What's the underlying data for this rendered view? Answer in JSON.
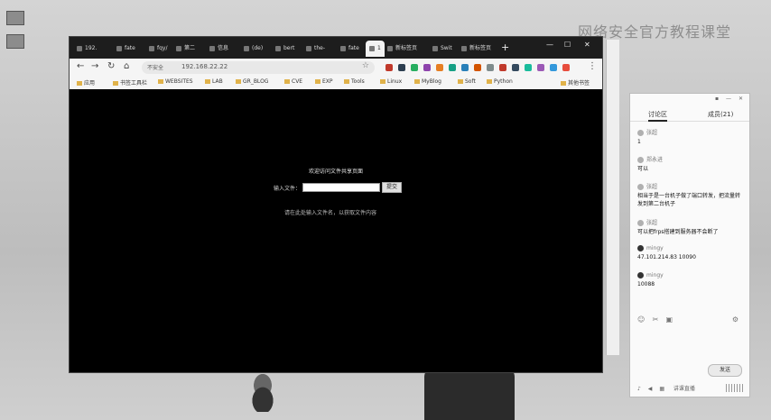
{
  "watermark": "网络安全官方教程课堂",
  "browser": {
    "tabs": [
      "192.",
      "fate",
      "fqy/",
      "第二",
      "信息",
      "(de)",
      "bert",
      "the-",
      "fate",
      "1"
    ],
    "extra_tabs": [
      "新标签页",
      "Swit",
      "新标签页"
    ],
    "omnibox": {
      "security": "不安全",
      "url": "192.168.22.22"
    },
    "bookmarks": [
      "应用",
      "书签工具栏",
      "WEBSITES",
      "LAB",
      "GR_BLOG",
      "CVE",
      "EXP",
      "Tools",
      "Linux",
      "MyBlog",
      "Soft",
      "Python",
      "其他书签"
    ],
    "page": {
      "title": "欢迎访问文件共享页面",
      "input_label": "输入文件：",
      "submit_label": "提交",
      "hint": "请在此处输入文件名，以获取文件内容"
    }
  },
  "chat": {
    "tabs": [
      "讨论区",
      "成员(21)"
    ],
    "messages": [
      {
        "user": "张超",
        "text": "1"
      },
      {
        "user": "郑永进",
        "text": "可以"
      },
      {
        "user": "张超",
        "text": "相当于是一台机子做了端口转发，把流量转发到第二台机子"
      },
      {
        "user": "张超",
        "text": "可以把frps搭建到服务器不会断了"
      },
      {
        "user": "mingy",
        "text": "47.101.214.83 10090"
      },
      {
        "user": "mingy",
        "text": "10088"
      }
    ],
    "send_label": "发送",
    "bottom_label": "讲课直播"
  }
}
